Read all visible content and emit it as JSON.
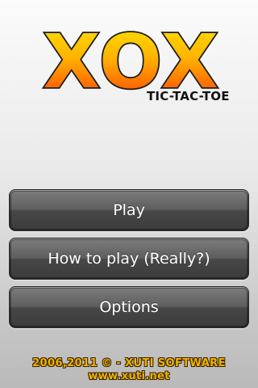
{
  "logo": {
    "title": "XOX",
    "subtitle": "TIC-TAC-TOE"
  },
  "menu": {
    "play_label": "Play",
    "how_to_play_label": "How to play (Really?)",
    "options_label": "Options"
  },
  "footer": {
    "copyright": "2006,2011 © - XUTI SOFTWARE",
    "website": "www.xuti.net"
  },
  "colors": {
    "logo_gradient_top": "#ffe000",
    "logo_gradient_bottom": "#ff3c00",
    "button_gradient_top": "#7e7e7e",
    "button_gradient_bottom": "#3c3c3c",
    "footer_text": "#f0b400"
  }
}
